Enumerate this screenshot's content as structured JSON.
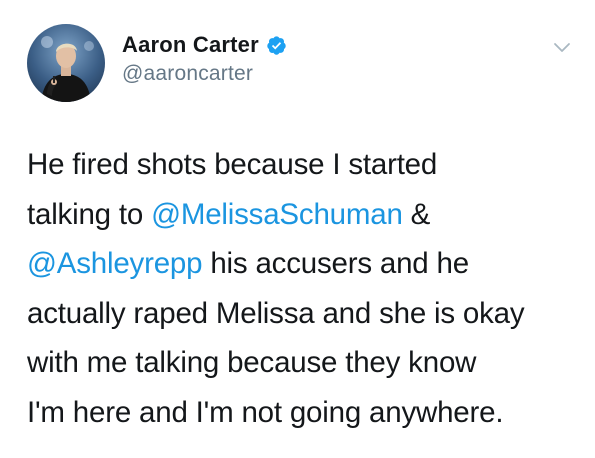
{
  "user": {
    "display_name": "Aaron Carter",
    "handle": "@aaroncarter",
    "verified": true
  },
  "tweet": {
    "lines": [
      [
        {
          "t": "He fired shots because I started"
        }
      ],
      [
        {
          "t": "talking to "
        },
        {
          "m": "@MelissaSchuman"
        },
        {
          "t": " &"
        }
      ],
      [
        {
          "m": "@Ashleyrepp"
        },
        {
          "t": " his accusers and he"
        }
      ],
      [
        {
          "t": "actually raped Melissa and she is okay"
        }
      ],
      [
        {
          "t": "with me talking because they know"
        }
      ],
      [
        {
          "t": "I'm here and I'm not going anywhere."
        }
      ]
    ]
  },
  "colors": {
    "mention": "#1b95e0",
    "verified_badge": "#1da1f2",
    "secondary_text": "#657786"
  },
  "icons": {
    "verified": "verified-badge-icon",
    "menu": "chevron-down-icon"
  }
}
